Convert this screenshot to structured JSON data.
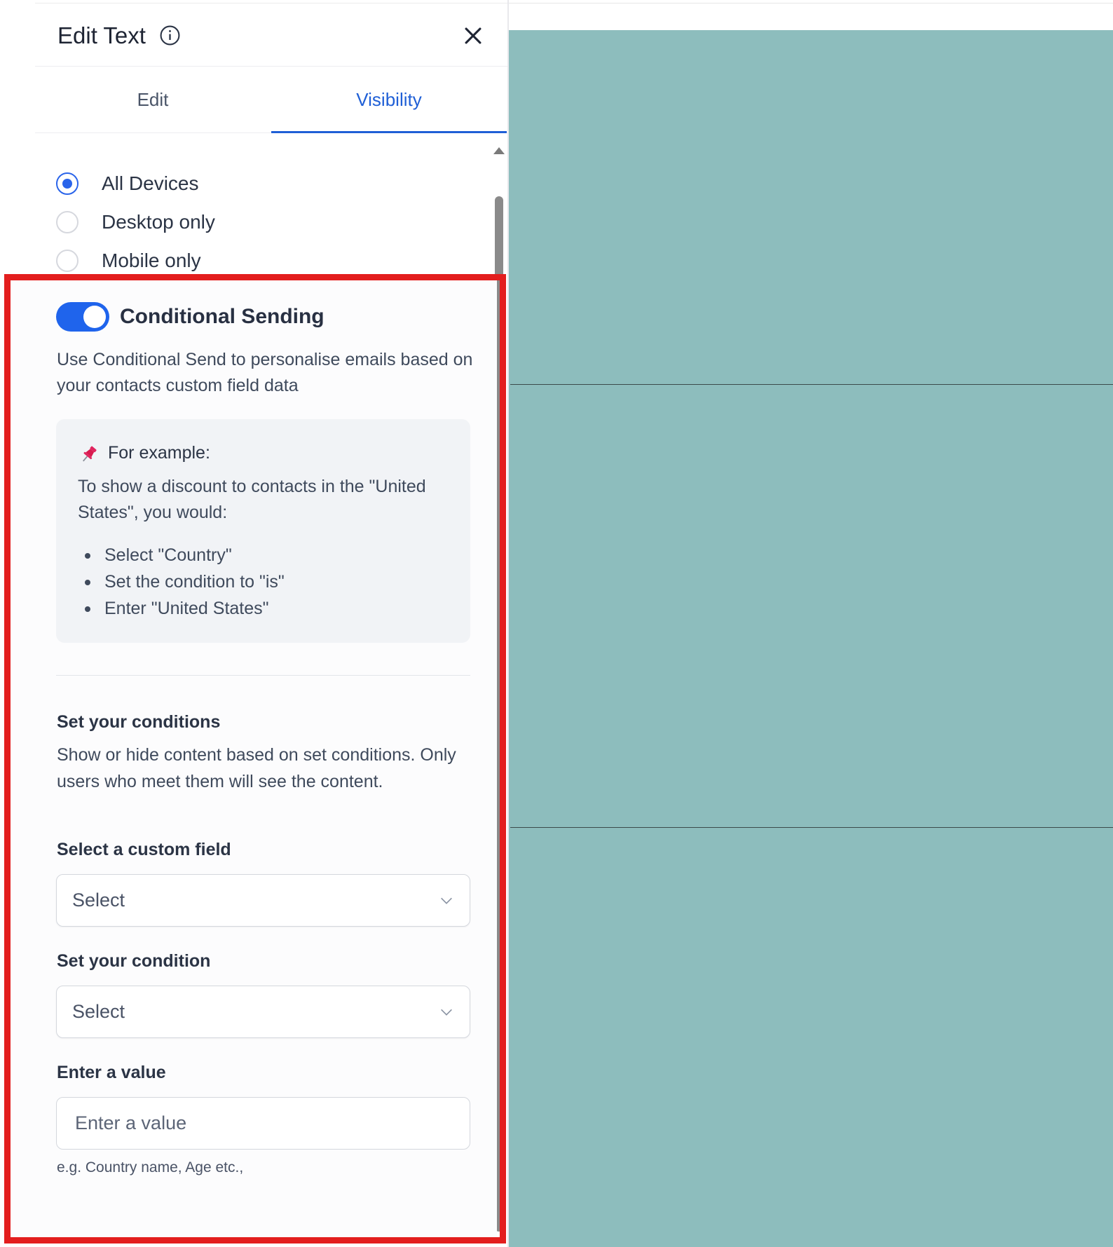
{
  "header": {
    "title": "Edit Text",
    "info_icon": "info-circle-icon",
    "close_icon": "close-x-icon"
  },
  "tabs": [
    {
      "label": "Edit",
      "active": false
    },
    {
      "label": "Visibility",
      "active": true
    }
  ],
  "device_visibility": {
    "options": [
      {
        "label": "All Devices",
        "checked": true
      },
      {
        "label": "Desktop only",
        "checked": false
      },
      {
        "label": "Mobile only",
        "checked": false
      }
    ]
  },
  "conditional_sending": {
    "enabled": true,
    "title": "Conditional Sending",
    "description": "Use Conditional Send to personalise emails based on your contacts custom field data",
    "example": {
      "icon": "pushpin-icon",
      "heading": "For example:",
      "text": "To show a discount to contacts in the \"United States\", you would:",
      "steps": [
        "Select \"Country\"",
        "Set the condition to \"is\"",
        "Enter \"United States\""
      ]
    },
    "conditions": {
      "title": "Set your conditions",
      "description": "Show or hide content based on set conditions. Only users who meet them will see the content."
    },
    "custom_field": {
      "label": "Select a custom field",
      "value": "Select"
    },
    "condition": {
      "label": "Set your condition",
      "value": "Select"
    },
    "value_input": {
      "label": "Enter a value",
      "placeholder": "Enter a value",
      "value": "",
      "hint": "e.g. Country name, Age etc.,"
    }
  },
  "colors": {
    "accent": "#1f64ec",
    "canvas_background": "#8dbdbd",
    "highlight_border": "#e31e1e"
  }
}
